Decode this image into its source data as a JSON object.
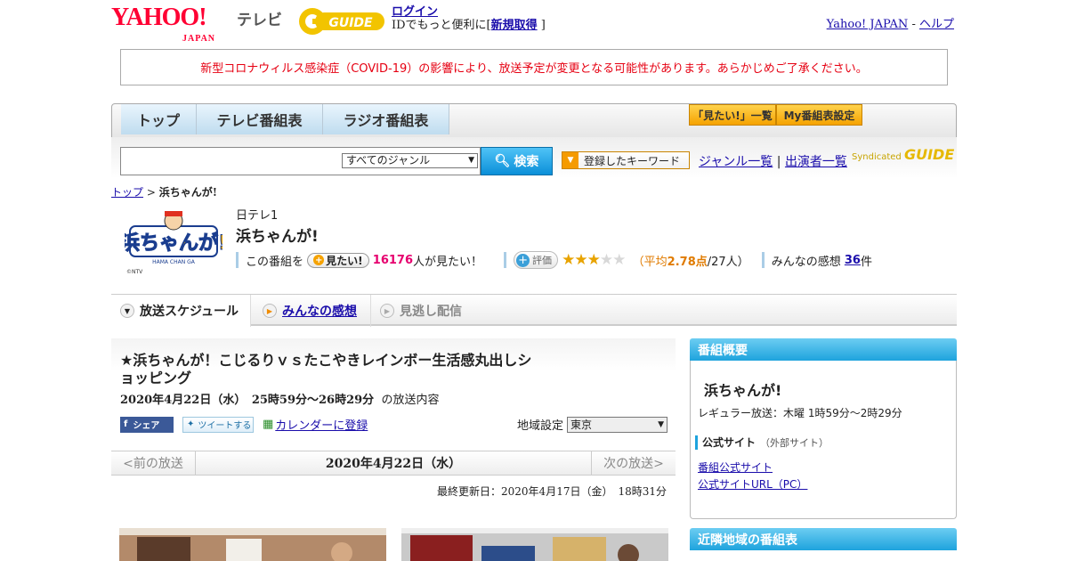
{
  "header": {
    "yahoo_logo": "YAHOO!",
    "yahoo_sub": "JAPAN",
    "tv_label": "テレビ",
    "gguide_logo": "GUIDE",
    "login": "ログイン",
    "login_prompt_prefix": "IDでもっと便利に[",
    "signup": "新規取得",
    "login_prompt_suffix": "]",
    "yahoo_japan_link": "Yahoo! JAPAN",
    "separator": "-",
    "help_link": "ヘルプ"
  },
  "notice": "新型コロナウィルス感染症（COVID-19）の影響により、放送予定が変更となる可能性があります。あらかじめご了承ください。",
  "nav": {
    "tabs": [
      "トップ",
      "テレビ番組表",
      "ラジオ番組表"
    ],
    "mitai_list": "「見たい!」一覧",
    "my_settings": "My番組表設定"
  },
  "search": {
    "genre_selected": "すべてのジャンル",
    "button": "検索",
    "keyword_button": "登録したキーワード",
    "genre_list": "ジャンル一覧",
    "link_separator": "|",
    "performer_list": "出演者一覧",
    "syndicated_label": "Syndicated",
    "syndicated_logo": "GUIDE"
  },
  "breadcrumb": {
    "top": "トップ",
    "sep": ">",
    "current": "浜ちゃんが!"
  },
  "program": {
    "thumb_text": "浜ちゃんが!",
    "thumb_sub": "HAMA CHAN GA",
    "copyright": "©NTV",
    "channel": "日テレ1",
    "title": "浜ちゃんが!",
    "mitai_prefix": "この番組を",
    "mitai_button": "見たい!",
    "mitai_count": "16176",
    "mitai_suffix": "人が見たい！",
    "rating_button": "評価",
    "rating_value": 2.78,
    "rating_stars_filled": "★★★",
    "rating_stars_empty": "★★",
    "rating_prefix": "（平均",
    "rating_avg": "2.78点",
    "rating_count": "/27人）",
    "reviews_prefix": "みんなの感想",
    "reviews_count": "36",
    "reviews_suffix": "件"
  },
  "sched_tabs": [
    "放送スケジュール",
    "みんなの感想",
    "見逃し配信"
  ],
  "episode": {
    "title": "★浜ちゃんが！こじるりｖｓたこやきレインボー生活感丸出しショッピング",
    "datetime": "2020年4月22日（水）　25時59分～26時29分",
    "datetime_suffix": "の放送内容",
    "share_fb": "シェア",
    "share_tw": "ツイートする",
    "calendar": "カレンダーに登録",
    "region_label": "地域設定",
    "region_value": "東京",
    "prev": "<前の放送",
    "current_date": "2020年4月22日（水）",
    "next": "次の放送>",
    "updated": "最終更新日：2020年4月17日（金）　18時31分"
  },
  "sidebar": {
    "overview_title": "番組概要",
    "program_name": "浜ちゃんが!",
    "regular": "レギュラー放送：木曜 1時59分～2時29分",
    "official_label": "公式サイト",
    "official_sub": "（外部サイト）",
    "link1": "番組公式サイト",
    "link2": "公式サイトURL（PC）",
    "nearby_title": "近隣地域の番組表"
  },
  "colors": {
    "brand_red": "#ff0033",
    "accent_blue": "#1d8fd1",
    "notice_red": "#e60012",
    "highlight_pink": "#e6006e",
    "rating_orange": "#e07b00"
  }
}
